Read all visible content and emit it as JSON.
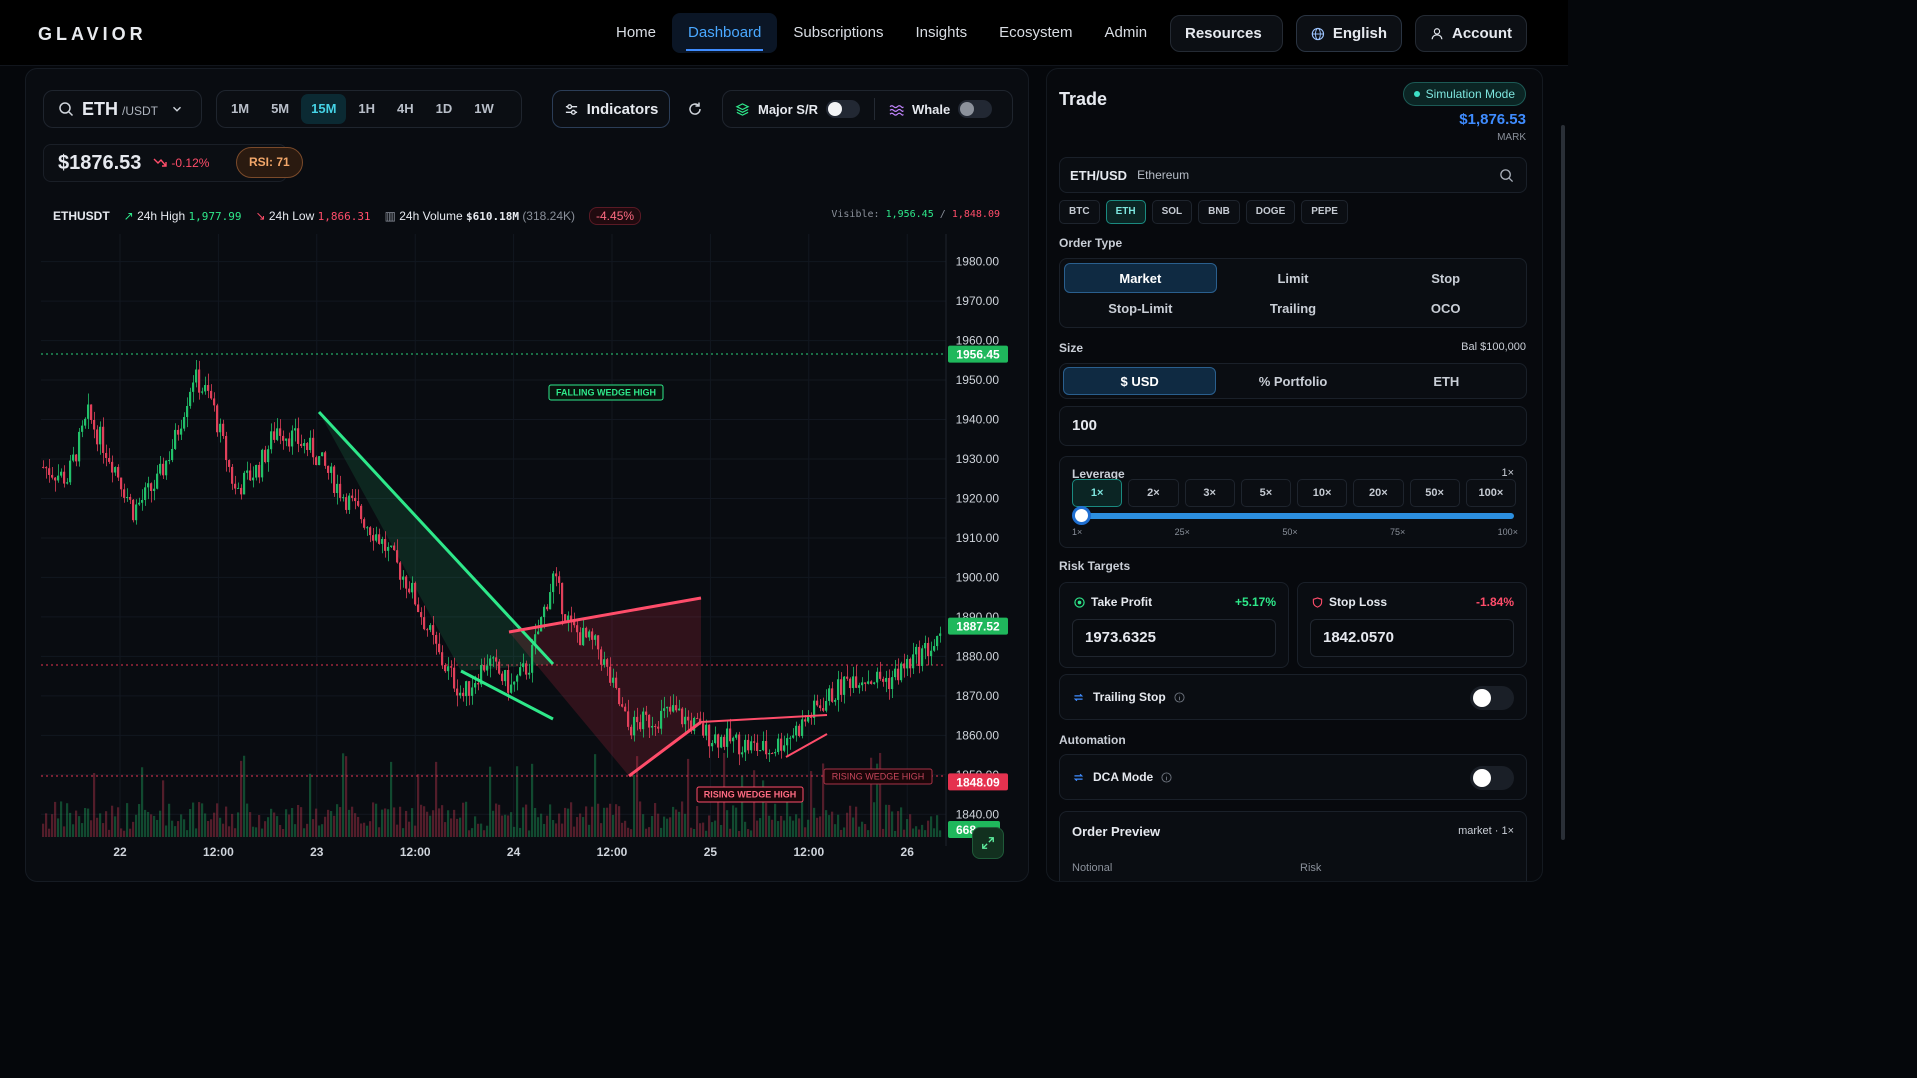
{
  "brand": "GLAVIOR",
  "nav": {
    "links": [
      "Home",
      "Dashboard",
      "Subscriptions",
      "Insights",
      "Ecosystem",
      "Admin"
    ],
    "active": 1,
    "resources": "Resources",
    "language": "English",
    "account": "Account"
  },
  "toolbar": {
    "symbol": "ETH",
    "quote": "/USDT",
    "timeframes": [
      "1M",
      "5M",
      "15M",
      "1H",
      "4H",
      "1D",
      "1W"
    ],
    "active_timeframe": 2,
    "indicators": "Indicators",
    "major_sr": "Major S/R",
    "whale": "Whale"
  },
  "ticker": {
    "price": "$1876.53",
    "change": "-0.12%",
    "rsi": "RSI: 71",
    "pair": "ETHUSDT",
    "high_label": "24h High",
    "high": "1,977.99",
    "low_label": "24h Low",
    "low": "1,866.31",
    "vol_label": "24h Volume",
    "vol": "$610.18M",
    "vol_units": "(318.24K)",
    "day_change": "-4.45%",
    "visible_label": "Visible:",
    "visible_high": "1,956.45",
    "visible_sep": "/",
    "visible_low": "1,848.09"
  },
  "chart_data": {
    "type": "candlestick",
    "x_ticks": [
      "22",
      "12:00",
      "23",
      "12:00",
      "24",
      "12:00",
      "25",
      "12:00",
      "26"
    ],
    "y_ticks": [
      "1980.00",
      "1970.00",
      "1960.00",
      "1950.00",
      "1940.00",
      "1930.00",
      "1920.00",
      "1910.00",
      "1900.00",
      "1890.00",
      "1880.00",
      "1870.00",
      "1860.00",
      "1850.00",
      "1840.00"
    ],
    "y_range": [
      1835,
      1987
    ],
    "path": [
      [
        0,
        1928
      ],
      [
        8,
        1925
      ],
      [
        15,
        1941
      ],
      [
        24,
        1928
      ],
      [
        30,
        1917
      ],
      [
        38,
        1924
      ],
      [
        44,
        1935
      ],
      [
        50,
        1951
      ],
      [
        56,
        1945
      ],
      [
        64,
        1922
      ],
      [
        72,
        1928
      ],
      [
        78,
        1938
      ],
      [
        90,
        1932
      ],
      [
        100,
        1921
      ],
      [
        112,
        1910
      ],
      [
        122,
        1898
      ],
      [
        132,
        1880
      ],
      [
        140,
        1870
      ],
      [
        148,
        1879
      ],
      [
        156,
        1872
      ],
      [
        162,
        1878
      ],
      [
        170,
        1900
      ],
      [
        176,
        1887
      ],
      [
        185,
        1882
      ],
      [
        195,
        1862
      ],
      [
        210,
        1866
      ],
      [
        222,
        1860
      ],
      [
        232,
        1858
      ],
      [
        242,
        1856
      ],
      [
        252,
        1862
      ],
      [
        258,
        1867
      ],
      [
        270,
        1875
      ],
      [
        282,
        1874
      ],
      [
        293,
        1881
      ],
      [
        300,
        1884
      ]
    ],
    "price_labels": [
      {
        "value": 1956.45,
        "label": "1956.45",
        "color": "#1fb85c"
      },
      {
        "value": 1887.52,
        "label": "1887.52",
        "color": "#1fb85c"
      },
      {
        "value": 1848.09,
        "label": "1848.09",
        "color": "#e5324f"
      }
    ],
    "volume_label": "668",
    "annotations": {
      "falling_wedge": "FALLING WEDGE HIGH",
      "rising_wedge_a": "RISING WEDGE HIGH",
      "rising_wedge_b": "RISING WEDGE HIGH"
    }
  },
  "trade": {
    "title": "Trade",
    "mode": "Simulation Mode",
    "mark_price": "$1,876.53",
    "mark_label": "MARK",
    "pair": "ETH/USD",
    "pair_name": "Ethereum",
    "coins": [
      "BTC",
      "ETH",
      "SOL",
      "BNB",
      "DOGE",
      "PEPE"
    ],
    "active_coin": 1,
    "order_type_label": "Order Type",
    "order_types": [
      "Market",
      "Limit",
      "Stop",
      "Stop-Limit",
      "Trailing",
      "OCO"
    ],
    "active_order": 0,
    "size_label": "Size",
    "balance": "Bal $100,000",
    "size_units": [
      "$ USD",
      "% Portfolio",
      "ETH"
    ],
    "active_unit": 0,
    "amount": "100",
    "leverage_label": "Leverage",
    "leverage_value": "1×",
    "leverage_options": [
      "1×",
      "2×",
      "3×",
      "5×",
      "10×",
      "20×",
      "50×",
      "100×"
    ],
    "active_leverage": 0,
    "slider_ticks": [
      "1×",
      "25×",
      "50×",
      "75×",
      "100×"
    ],
    "slider_fraction": 0,
    "risk_label": "Risk Targets",
    "tp_label": "Take Profit",
    "tp_pct": "+5.17%",
    "tp_value": "1973.6325",
    "sl_label": "Stop Loss",
    "sl_pct": "-1.84%",
    "sl_value": "1842.0570",
    "trailing": "Trailing Stop",
    "automation_label": "Automation",
    "dca": "DCA Mode",
    "preview_title": "Order Preview",
    "preview_meta": "market · 1×",
    "notional": "Notional",
    "risk": "Risk"
  },
  "colors": {
    "accent": "#3f8cff",
    "up": "#2ee88a",
    "down": "#ff4d6a",
    "teal": "#45d3e6"
  }
}
